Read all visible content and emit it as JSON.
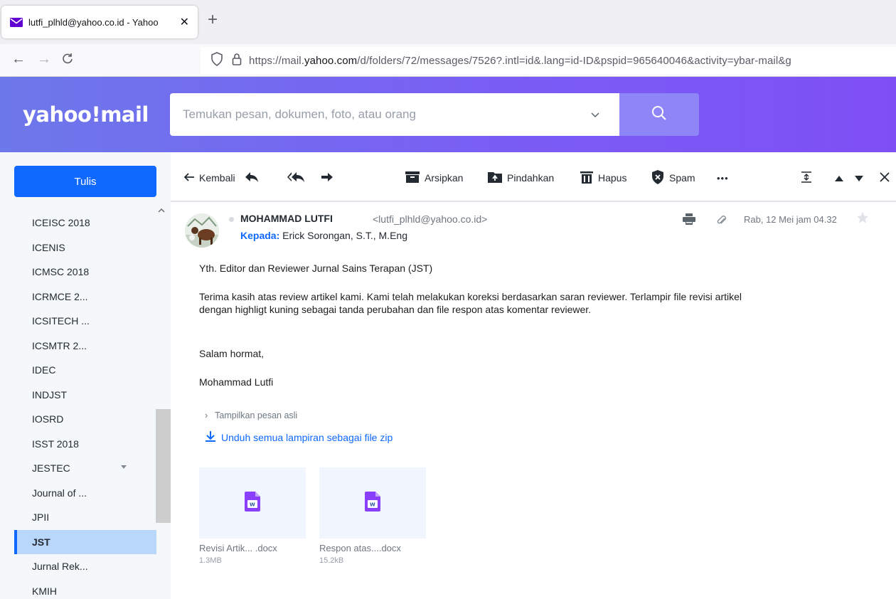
{
  "browser": {
    "tab_title": "lutfi_plhld@yahoo.co.id - Yahoo",
    "url_prefix": "https://mail.",
    "url_domain": "yahoo.com",
    "url_suffix": "/d/folders/72/messages/7526?.intl=id&.lang=id-ID&pspid=965640046&activity=ybar-mail&g"
  },
  "header": {
    "logo": "yahoo!mail",
    "search_placeholder": "Temukan pesan, dokumen, foto, atau orang"
  },
  "sidebar": {
    "compose_label": "Tulis",
    "folders": [
      {
        "label": "ICEISC 2018"
      },
      {
        "label": "ICENIS"
      },
      {
        "label": "ICMSC 2018"
      },
      {
        "label": "ICRMCE 2..."
      },
      {
        "label": "ICSITECH ..."
      },
      {
        "label": "ICSMTR 2..."
      },
      {
        "label": "IDEC"
      },
      {
        "label": "INDJST"
      },
      {
        "label": "IOSRD"
      },
      {
        "label": "ISST 2018"
      },
      {
        "label": "JESTEC"
      },
      {
        "label": "Journal of ..."
      },
      {
        "label": "JPII"
      },
      {
        "label": "JST"
      },
      {
        "label": "Jurnal Rek..."
      },
      {
        "label": "KMIH"
      }
    ]
  },
  "toolbar": {
    "back_label": "Kembali",
    "archive_label": "Arsipkan",
    "move_label": "Pindahkan",
    "delete_label": "Hapus",
    "spam_label": "Spam",
    "more_label": "•••"
  },
  "message": {
    "sender_name": "MOHAMMAD LUTFI",
    "sender_email": "<lutfi_plhld@yahoo.co.id>",
    "to_label": "Kepada:",
    "to_value": "Erick Sorongan, S.T., M.Eng",
    "date": "Rab, 12 Mei jam 04.32",
    "body_greeting": "Yth. Editor dan Reviewer Jurnal Sains Terapan (JST)",
    "body_line1": "Terima kasih atas review artikel kami. Kami telah melakukan koreksi berdasarkan saran reviewer. Terlampir file revisi artikel",
    "body_line2": "dengan highligt kuning sebagai tanda perubahan dan file respon atas komentar reviewer.",
    "closing": "Salam hormat,",
    "signature": "Mohammad Lutfi",
    "show_original": "Tampilkan pesan asli",
    "download_all": "Unduh semua lampiran sebagai file zip",
    "attachments": [
      {
        "name": "Revisi Artik... .docx",
        "size": "1.3MB"
      },
      {
        "name": "Respon atas....docx",
        "size": "15.2kB"
      }
    ]
  },
  "colors": {
    "accent": "#0f69ff",
    "header_start": "#6d78ea",
    "header_end": "#7e4ff5",
    "active_folder": "#b9d7fb"
  }
}
